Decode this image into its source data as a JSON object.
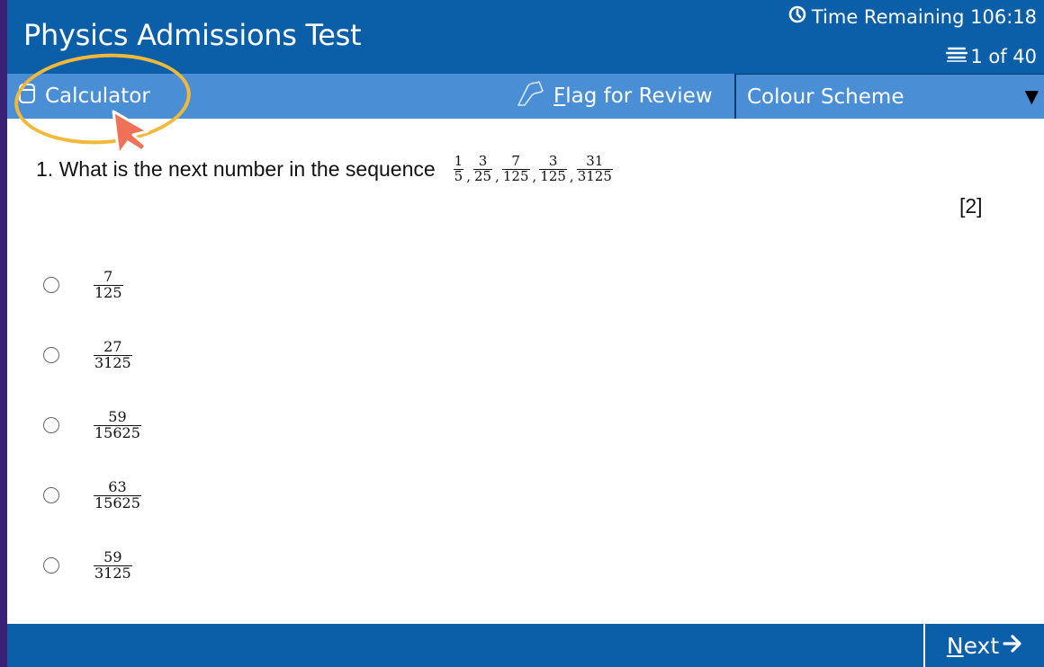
{
  "header": {
    "title": "Physics Admissions Test",
    "timer_label": "Time Remaining 106:18",
    "question_counter": "1 of 40"
  },
  "toolbar": {
    "calculator_label": "Calculator",
    "flag_label_accel": "F",
    "flag_label_rest": "lag for Review",
    "colour_scheme_label": "Colour Scheme"
  },
  "question": {
    "text": "1. What is the next number in the sequence",
    "sequence": [
      {
        "num": "1",
        "den": "5"
      },
      {
        "num": "3",
        "den": "25"
      },
      {
        "num": "7",
        "den": "125"
      },
      {
        "num": "3",
        "den": "125"
      },
      {
        "num": "31",
        "den": "3125"
      }
    ],
    "marks": "[2]"
  },
  "options": [
    {
      "num": "7",
      "den": "125"
    },
    {
      "num": "27",
      "den": "3125"
    },
    {
      "num": "59",
      "den": "15625"
    },
    {
      "num": "63",
      "den": "15625"
    },
    {
      "num": "59",
      "den": "3125"
    }
  ],
  "footer": {
    "next_accel": "N",
    "next_rest": "ext"
  },
  "colors": {
    "header_bg": "#0b5ea8",
    "toolbar_bg": "#4a8fd6",
    "highlight": "#f2b83a",
    "background": "#3b2176"
  },
  "icons": {
    "timer": "clock-icon",
    "counter": "question-list-icon",
    "calculator": "calculator-icon",
    "flag": "flag-icon",
    "dropdown": "caret-down-icon",
    "next": "arrow-right-icon",
    "pointer": "mouse-cursor-icon"
  }
}
